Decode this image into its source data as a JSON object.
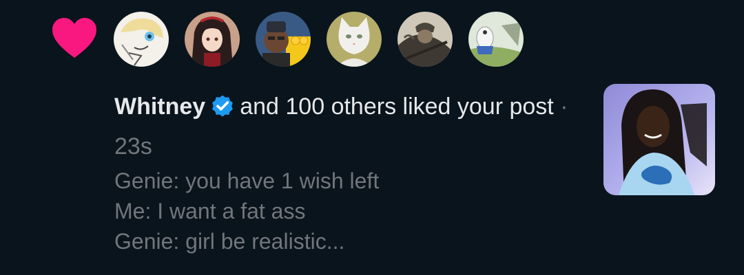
{
  "notification": {
    "type_icon": "heart-icon",
    "type_color": "#f91880",
    "avatars": [
      {
        "icon": "avatar-cartoon-character"
      },
      {
        "icon": "avatar-anime-girl"
      },
      {
        "icon": "avatar-man-with-emojis"
      },
      {
        "icon": "avatar-white-cat"
      },
      {
        "icon": "avatar-soldier"
      },
      {
        "icon": "avatar-cartoon-figure"
      }
    ],
    "actor_name": "Whitney",
    "verified_icon": "verified-badge-icon",
    "verified_color": "#1d9bf0",
    "action_text": "and 100 others liked your post",
    "separator": "·",
    "timestamp": "23s",
    "post_preview": [
      "Genie: you have 1 wish left",
      "Me: I want a fat ass",
      "Genie: girl be realistic..."
    ],
    "thumbnail_icon": "post-media-thumbnail"
  }
}
